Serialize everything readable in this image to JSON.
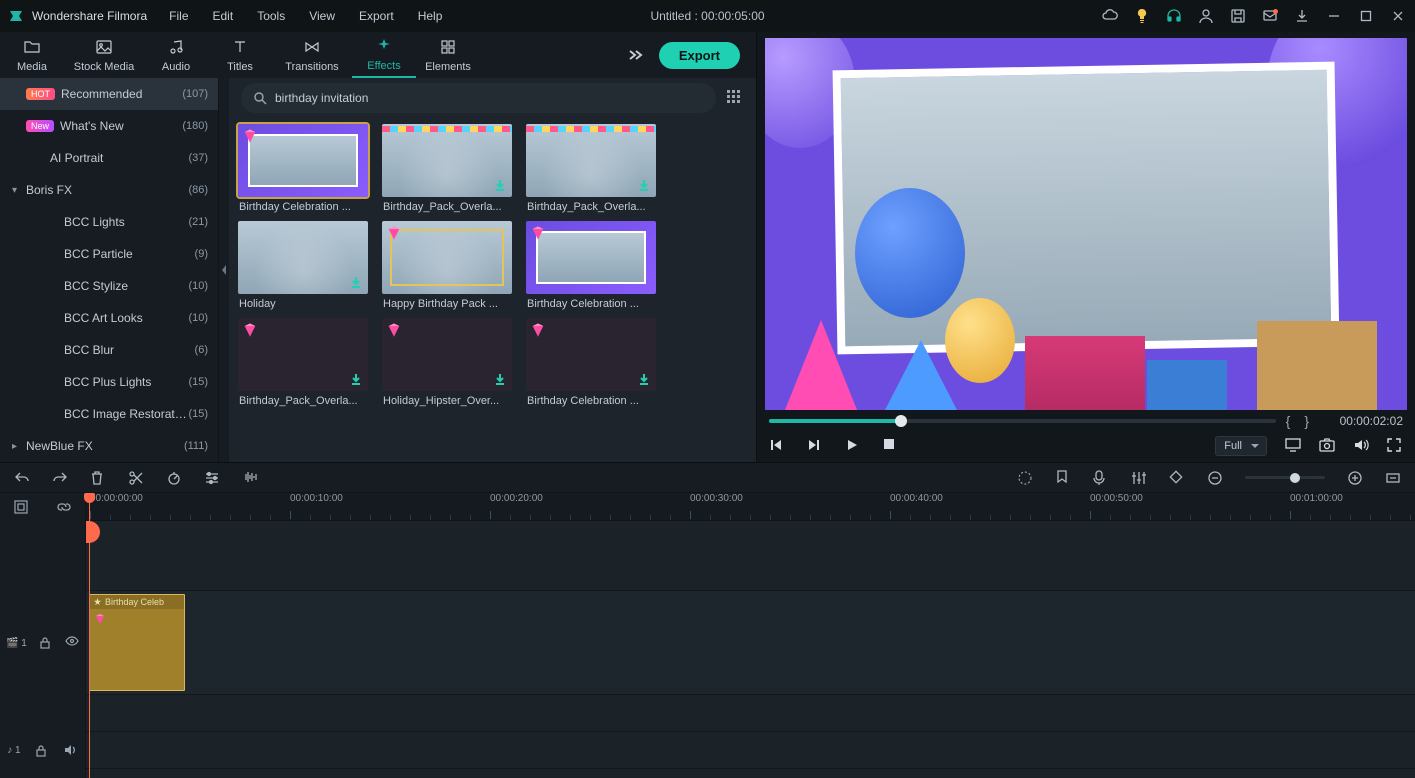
{
  "app_name": "Wondershare Filmora",
  "menu": [
    "File",
    "Edit",
    "Tools",
    "View",
    "Export",
    "Help"
  ],
  "project_title": "Untitled : 00:00:05:00",
  "export_label": "Export",
  "tabs": [
    {
      "id": "media",
      "label": "Media"
    },
    {
      "id": "stock",
      "label": "Stock Media"
    },
    {
      "id": "audio",
      "label": "Audio"
    },
    {
      "id": "titles",
      "label": "Titles"
    },
    {
      "id": "transitions",
      "label": "Transitions"
    },
    {
      "id": "effects",
      "label": "Effects"
    },
    {
      "id": "elements",
      "label": "Elements"
    }
  ],
  "active_tab": "effects",
  "search": {
    "placeholder": "",
    "value": "birthday invitation"
  },
  "sidebar": [
    {
      "badge": "HOT",
      "label": "Recommended",
      "count": "(107)",
      "sel": true
    },
    {
      "badge": "New",
      "label": "What's New",
      "count": "(180)"
    },
    {
      "indent": "sub2",
      "label": "AI Portrait",
      "count": "(37)"
    },
    {
      "chev": "▾",
      "label": "Boris FX",
      "count": "(86)"
    },
    {
      "indent": "sub",
      "label": "BCC Lights",
      "count": "(21)"
    },
    {
      "indent": "sub",
      "label": "BCC Particle",
      "count": "(9)"
    },
    {
      "indent": "sub",
      "label": "BCC Stylize",
      "count": "(10)"
    },
    {
      "indent": "sub",
      "label": "BCC Art Looks",
      "count": "(10)"
    },
    {
      "indent": "sub",
      "label": "BCC Blur",
      "count": "(6)"
    },
    {
      "indent": "sub",
      "label": "BCC Plus Lights",
      "count": "(15)"
    },
    {
      "indent": "sub",
      "label": "BCC Image Restoration",
      "count": "(15)"
    },
    {
      "chev": "▸",
      "label": "NewBlue FX",
      "count": "(111)"
    }
  ],
  "thumbs": [
    {
      "label": "Birthday Celebration ...",
      "style": "balloon-edge",
      "gem": true,
      "sel": true
    },
    {
      "label": "Birthday_Pack_Overla...",
      "style": "art-base bunting",
      "dl": true
    },
    {
      "label": "Birthday_Pack_Overla...",
      "style": "art-base bunting",
      "dl": true
    },
    {
      "label": "Holiday",
      "style": "art-base",
      "dl": true
    },
    {
      "label": "Happy Birthday Pack ...",
      "style": "art-base gold-frame",
      "gem": true,
      "frame": true
    },
    {
      "label": "Birthday Celebration ...",
      "style": "balloon-edge",
      "gem": true,
      "frame": true
    },
    {
      "label": "Birthday_Pack_Overla...",
      "style": "dark-hearts",
      "gem": true,
      "dl": true
    },
    {
      "label": "Holiday_Hipster_Over...",
      "style": "dark-hearts",
      "gem": true,
      "dl": true
    },
    {
      "label": "Birthday Celebration ...",
      "style": "dark-hearts",
      "gem": true,
      "dl": true
    }
  ],
  "preview": {
    "timecode": "00:00:02:02",
    "quality": "Full"
  },
  "ruler_marks": [
    "00:00:00:00",
    "00:00:10:00",
    "00:00:20:00",
    "00:00:30:00",
    "00:00:40:00",
    "00:00:50:00",
    "00:01:00:00"
  ],
  "clip": {
    "label": "Birthday Celeb"
  },
  "track_labels": {
    "video": "1",
    "audio": "1"
  }
}
